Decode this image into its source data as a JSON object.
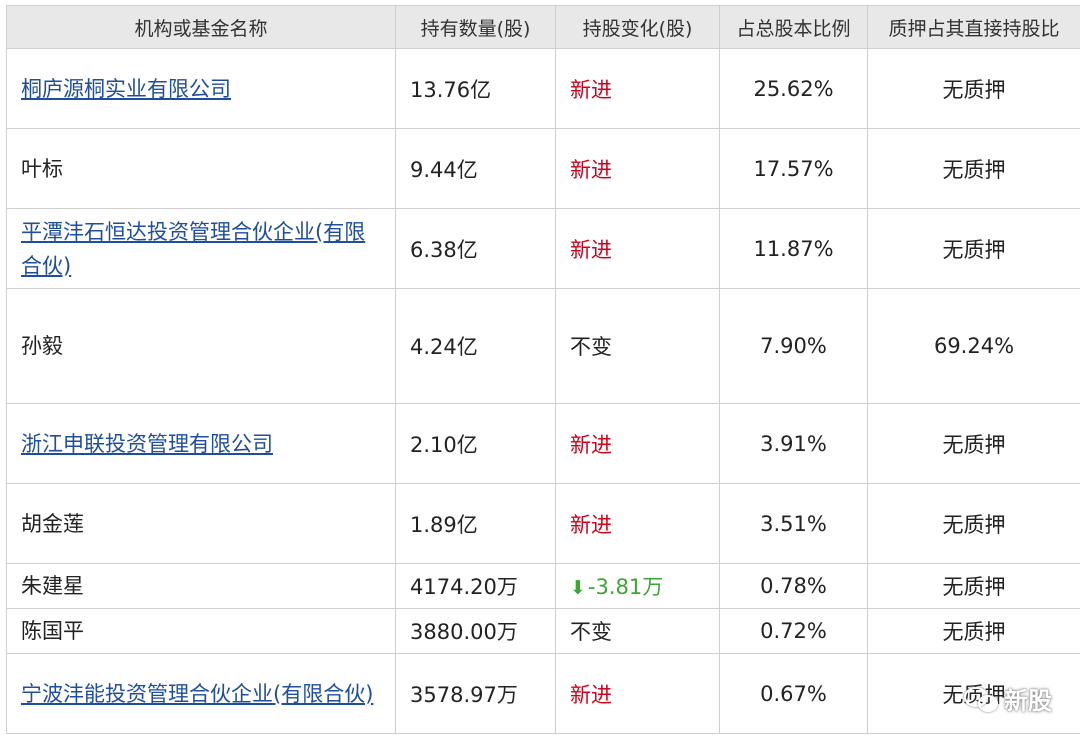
{
  "table": {
    "headers": [
      "机构或基金名称",
      "持有数量(股)",
      "持股变化(股)",
      "占总股本比例",
      "质押占其直接持股比"
    ],
    "rows": [
      {
        "name": "桐庐源桐实业有限公司",
        "qty": "13.76亿",
        "change": "新进",
        "change_type": "new",
        "pct": "25.62%",
        "pledge": "无质押",
        "link": true
      },
      {
        "name": "叶标",
        "qty": "9.44亿",
        "change": "新进",
        "change_type": "new",
        "pct": "17.57%",
        "pledge": "无质押",
        "link": false
      },
      {
        "name": "平潭沣石恒达投资管理合伙企业(有限合伙)",
        "qty": "6.38亿",
        "change": "新进",
        "change_type": "new",
        "pct": "11.87%",
        "pledge": "无质押",
        "link": true
      },
      {
        "name": "孙毅",
        "qty": "4.24亿",
        "change": "不变",
        "change_type": "same",
        "pct": "7.90%",
        "pledge": "69.24%",
        "link": false
      },
      {
        "name": "浙江申联投资管理有限公司",
        "qty": "2.10亿",
        "change": "新进",
        "change_type": "new",
        "pct": "3.91%",
        "pledge": "无质押",
        "link": true
      },
      {
        "name": "胡金莲",
        "qty": "1.89亿",
        "change": "新进",
        "change_type": "new",
        "pct": "3.51%",
        "pledge": "无质押",
        "link": false
      },
      {
        "name": "朱建星",
        "qty": "4174.20万",
        "change": "-3.81万",
        "change_type": "down",
        "pct": "0.78%",
        "pledge": "无质押",
        "link": false
      },
      {
        "name": "陈国平",
        "qty": "3880.00万",
        "change": "不变",
        "change_type": "same",
        "pct": "0.72%",
        "pledge": "无质押",
        "link": false
      },
      {
        "name": "宁波沣能投资管理合伙企业(有限合伙)",
        "qty": "3578.97万",
        "change": "新进",
        "change_type": "new",
        "pct": "0.67%",
        "pledge": "无质押",
        "link": true
      }
    ]
  },
  "colors": {
    "link": "#1f4e9c",
    "new": "#d0021b",
    "down": "#3ca635",
    "header_bg": "#e8e8e8",
    "border": "#cfcfcf"
  },
  "icons": {
    "down": "down-arrow-icon",
    "watermark": "wechat-logo-icon"
  },
  "watermark": {
    "text": "新股"
  }
}
